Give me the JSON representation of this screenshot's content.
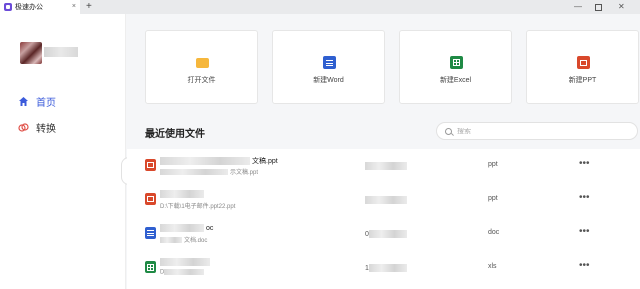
{
  "window": {
    "tab_title": "极速办公",
    "new_tab": "+",
    "tab_close": "×",
    "minimize": "—",
    "close": "✕"
  },
  "sidebar": {
    "nav": [
      {
        "label": "首页",
        "icon": "home-icon",
        "active": true
      },
      {
        "label": "转换",
        "icon": "convert-icon",
        "active": false
      }
    ]
  },
  "quick_actions": [
    {
      "label": "打开文件",
      "icon": "folder-icon",
      "color": "#f6b73c"
    },
    {
      "label": "新建Word",
      "icon": "word-icon",
      "color": "#2f5fd0"
    },
    {
      "label": "新建Excel",
      "icon": "excel-icon",
      "color": "#1f8a45"
    },
    {
      "label": "新建PPT",
      "icon": "ppt-icon",
      "color": "#d9482b"
    }
  ],
  "recent": {
    "title": "最近使用文件",
    "search_placeholder": "搜索",
    "files": [
      {
        "name_tail": "文稿.ppt",
        "path_tail": "示文稿.ppt",
        "time_head": "",
        "type": "ppt",
        "icon": "ppt-file-icon",
        "more": "•••"
      },
      {
        "name_tail": "",
        "path": "D:\\下载\\1电子邮件.ppt22.ppt",
        "time_head": "",
        "type": "ppt",
        "icon": "ppt-file-icon",
        "more": "•••"
      },
      {
        "name_tail": "oc",
        "path_tail": "文档.doc",
        "time_head": "0",
        "type": "doc",
        "icon": "word-file-icon",
        "more": "•••"
      },
      {
        "name_tail": "",
        "path": "D",
        "time_head": "1",
        "type": "xls",
        "icon": "excel-file-icon",
        "more": "•••"
      }
    ]
  },
  "collapse_symbol": "‹"
}
